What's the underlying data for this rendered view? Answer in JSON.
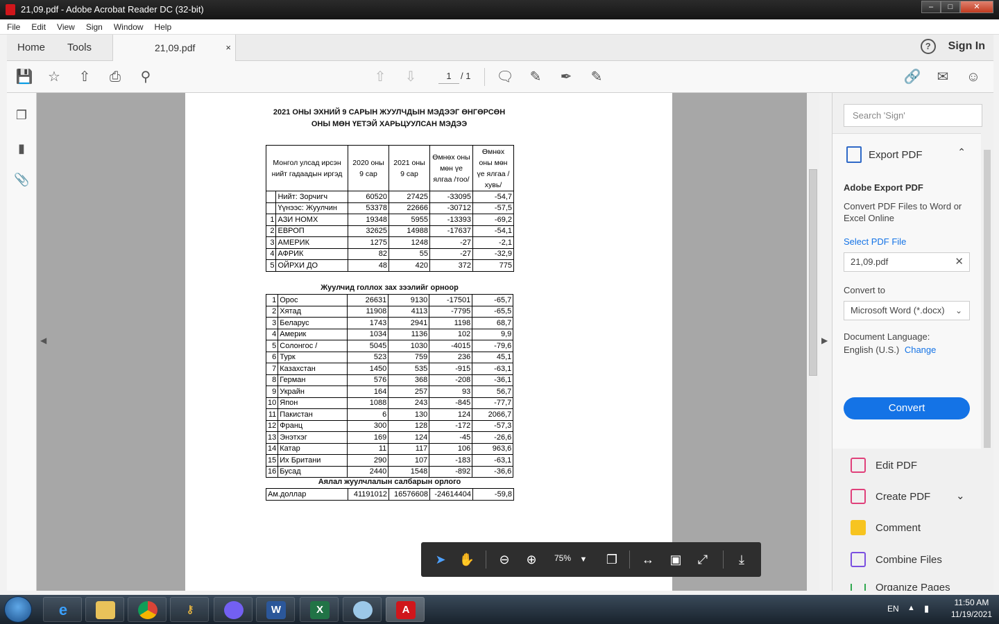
{
  "window": {
    "title": "21,09.pdf - Adobe Acrobat Reader DC (32-bit)",
    "min": "‒",
    "max": "□",
    "close": "✕"
  },
  "menu": [
    "File",
    "Edit",
    "View",
    "Sign",
    "Window",
    "Help"
  ],
  "tabs": {
    "home": "Home",
    "tools": "Tools",
    "doc": "21,09.pdf",
    "close": "×"
  },
  "header": {
    "help": "?",
    "signin": "Sign In"
  },
  "toolbar": {
    "page_current": "1",
    "page_total": "/ 1"
  },
  "document": {
    "title_line1": "2021 ОНЫ ЭХНИЙ 9 САРЫН ЖУУЛЧДЫН МЭДЭЭГ ӨНГӨРСӨН",
    "title_line2": "ОНЫ МӨН ҮЕТЭЙ ХАРЬЦУУЛСАН МЭДЭЭ",
    "headers": [
      "Монгол улсад ирсэн нийт гадаадын иргэд",
      "2020 оны 9 сар",
      "2021 оны 9 сар",
      "Өмнөх оны мөн үе ялгаа /тоо/",
      "Өмнөх оны мөн үе ялгаа /хувь/"
    ],
    "summary": [
      [
        "",
        "Нийт: Зорчигч",
        "60520",
        "27425",
        "-33095",
        "-54,7"
      ],
      [
        "",
        "Үүнээс: Жуулчин",
        "53378",
        "22666",
        "-30712",
        "-57,5"
      ],
      [
        "1",
        "АЗИ НОМХ",
        "19348",
        "5955",
        "-13393",
        "-69,2"
      ],
      [
        "2",
        "ЕВРОП",
        "32625",
        "14988",
        "-17637",
        "-54,1"
      ],
      [
        "3",
        "АМЕРИК",
        "1275",
        "1248",
        "-27",
        "-2,1"
      ],
      [
        "4",
        "АФРИК",
        "82",
        "55",
        "-27",
        "-32,9"
      ],
      [
        "5",
        "ОЙРХИ ДО",
        "48",
        "420",
        "372",
        "775"
      ]
    ],
    "section2": "Жуулчид голлох зах зээлийг орноор",
    "countries": [
      [
        "1",
        "Орос",
        "26631",
        "9130",
        "-17501",
        "-65,7"
      ],
      [
        "2",
        "Хятад",
        "11908",
        "4113",
        "-7795",
        "-65,5"
      ],
      [
        "3",
        "Беларус",
        "1743",
        "2941",
        "1198",
        "68,7"
      ],
      [
        "4",
        "Америк",
        "1034",
        "1136",
        "102",
        "9,9"
      ],
      [
        "5",
        "Солонгос /",
        "5045",
        "1030",
        "-4015",
        "-79,6"
      ],
      [
        "6",
        "Турк",
        "523",
        "759",
        "236",
        "45,1"
      ],
      [
        "7",
        "Казахстан",
        "1450",
        "535",
        "-915",
        "-63,1"
      ],
      [
        "8",
        "Герман",
        "576",
        "368",
        "-208",
        "-36,1"
      ],
      [
        "9",
        "Украйн",
        "164",
        "257",
        "93",
        "56,7"
      ],
      [
        "10",
        "Япон",
        "1088",
        "243",
        "-845",
        "-77,7"
      ],
      [
        "11",
        "Пакистан",
        "6",
        "130",
        "124",
        "2066,7"
      ],
      [
        "12",
        "Франц",
        "300",
        "128",
        "-172",
        "-57,3"
      ],
      [
        "13",
        "Энэтхэг",
        "169",
        "124",
        "-45",
        "-26,6"
      ],
      [
        "14",
        "Катар",
        "11",
        "117",
        "106",
        "963,6"
      ],
      [
        "15",
        "Их Британи",
        "290",
        "107",
        "-183",
        "-63,1"
      ],
      [
        "16",
        "Бусад",
        "2440",
        "1548",
        "-892",
        "-36,6"
      ]
    ],
    "section3": "Аялал жуулчлалын салбарын орлого",
    "income": [
      "Ам.доллар",
      "41191012",
      "16576608",
      "-24614404",
      "-59,8"
    ]
  },
  "floatbar": {
    "zoom": "75%"
  },
  "rightpanel": {
    "search_placeholder": "Search 'Sign'",
    "export_title": "Export PDF",
    "adobe_export": "Adobe Export PDF",
    "desc": "Convert PDF Files to Word or Excel Online",
    "select_file": "Select PDF File",
    "file": "21,09.pdf",
    "convert_to": "Convert to",
    "format": "Microsoft Word (*.docx)",
    "doc_lang_label": "Document Language:",
    "doc_lang": "English (U.S.)",
    "change": "Change",
    "convert": "Convert",
    "tools": [
      "Edit PDF",
      "Create PDF",
      "Comment",
      "Combine Files",
      "Organize Pages"
    ]
  },
  "taskbar": {
    "lang": "EN",
    "time": "11:50 AM",
    "date": "11/19/2021"
  },
  "colors": {
    "accent": "#1473e6",
    "acrobat_red": "#d0161b"
  }
}
